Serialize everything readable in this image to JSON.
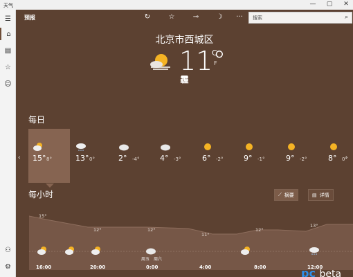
{
  "window": {
    "title": "天气",
    "minimize": "—",
    "maximize": "▢",
    "close": "✕"
  },
  "sidebar": {
    "items": [
      {
        "name": "menu",
        "icon": "☰"
      },
      {
        "name": "home",
        "icon": "⌂"
      },
      {
        "name": "maps",
        "icon": "▤"
      },
      {
        "name": "favorites",
        "icon": "☆"
      },
      {
        "name": "feedback",
        "icon": "☺"
      },
      {
        "name": "account",
        "icon": "⚇"
      },
      {
        "name": "settings",
        "icon": "⚙"
      }
    ]
  },
  "toolbar": {
    "section": "预报",
    "refresh_icon": "↻",
    "favorite_icon": "☆",
    "pin_icon": "⊸",
    "theme_icon": "☽",
    "more_icon": "···",
    "search_placeholder": "搜索",
    "search_icon": "⌕"
  },
  "current": {
    "city": "北京市西城区",
    "temp": "11°",
    "unit_c": "C",
    "unit_f": "F",
    "condition": "霾",
    "updated": "",
    "metrics": [
      "",
      "",
      "",
      "",
      "",
      "",
      "",
      ""
    ]
  },
  "daily": {
    "heading": "每日",
    "days": [
      {
        "label": "",
        "hi": "15°",
        "lo": "8°",
        "icon": "partly-cloudy"
      },
      {
        "label": "",
        "hi": "13°",
        "lo": "0°",
        "icon": "light-rain"
      },
      {
        "label": "",
        "hi": "2°",
        "lo": "-4°",
        "icon": "cloudy"
      },
      {
        "label": "",
        "hi": "4°",
        "lo": "-3°",
        "icon": "cloudy"
      },
      {
        "label": "",
        "hi": "6°",
        "lo": "-2°",
        "icon": "sunny"
      },
      {
        "label": "",
        "hi": "9°",
        "lo": "-1°",
        "icon": "sunny"
      },
      {
        "label": "",
        "hi": "9°",
        "lo": "-2°",
        "icon": "sunny"
      },
      {
        "label": "",
        "hi": "8°",
        "lo": "0°",
        "icon": "sunny"
      }
    ],
    "prev_icon": "‹",
    "next_icon": "›"
  },
  "hourly": {
    "heading": "每小时",
    "summary_button": "摘要",
    "detail_button": "详情",
    "temp_labels": [
      "15°",
      "12°",
      "12°",
      "11°",
      "12°",
      "13°"
    ],
    "time_labels": [
      "16:00",
      "20:00",
      "0:00",
      "4:00",
      "8:00",
      "12:00"
    ],
    "day_marks": [
      "周五",
      "周六"
    ]
  },
  "watermark": {
    "text": "beta",
    "logo": "pc"
  },
  "colors": {
    "background": "#5c4131",
    "selected": "#866451",
    "sun": "#f5b324"
  }
}
